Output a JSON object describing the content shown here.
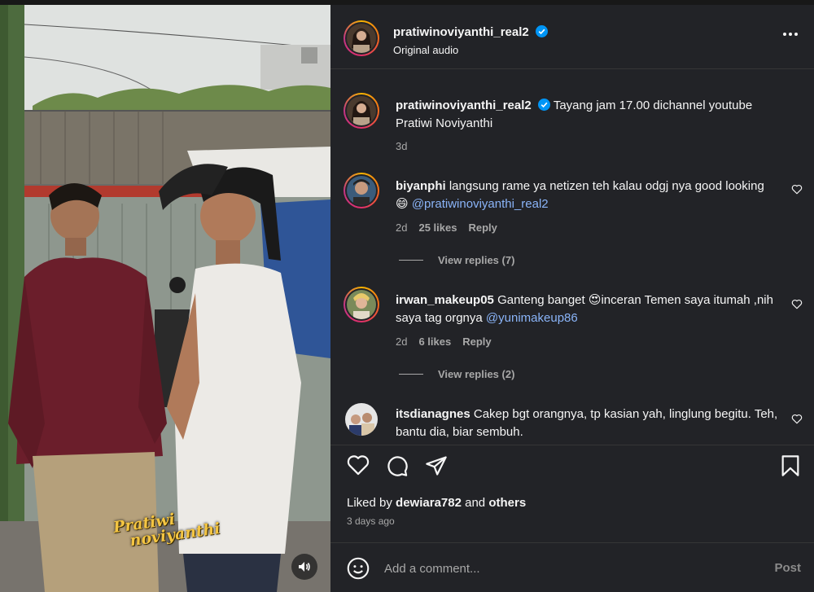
{
  "post": {
    "author": "pratiwinoviyanthi_real2",
    "audio": "Original audio",
    "verified_color": "#0095f6",
    "watermark_line1": "Pratiwi",
    "watermark_line2": "noviyanthi"
  },
  "caption": {
    "username": "pratiwinoviyanthi_real2",
    "text": "Tayang jam 17.00 dichannel youtube Pratiwi Noviyanthi",
    "time": "3d"
  },
  "comments": [
    {
      "username": "biyanphi",
      "text": "langsung rame ya netizen teh kalau odgj nya good looking 😄",
      "mention": "@pratiwinoviyanthi_real2",
      "time": "2d",
      "likes": "25 likes",
      "reply": "Reply",
      "view_replies": "View replies (7)"
    },
    {
      "username": "irwan_makeup05",
      "text": "Ganteng banget 😍inceran Temen saya itumah ,nih saya tag orgnya",
      "mention": "@yunimakeup86",
      "time": "2d",
      "likes": "6 likes",
      "reply": "Reply",
      "view_replies": "View replies (2)"
    },
    {
      "username": "itsdianagnes",
      "text": "Cakep bgt orangnya, tp kasian yah, linglung begitu. Teh, bantu dia, biar sembuh."
    }
  ],
  "actions": {
    "like_icon": "heart-icon",
    "comment_icon": "comment-icon",
    "share_icon": "share-icon",
    "save_icon": "bookmark-icon"
  },
  "likes_summary": {
    "prefix": "Liked by",
    "user": "dewiara782",
    "middle": "and",
    "suffix": "others"
  },
  "posted_ago": "3 days ago",
  "comment_box": {
    "placeholder": "Add a comment...",
    "post_label": "Post"
  }
}
